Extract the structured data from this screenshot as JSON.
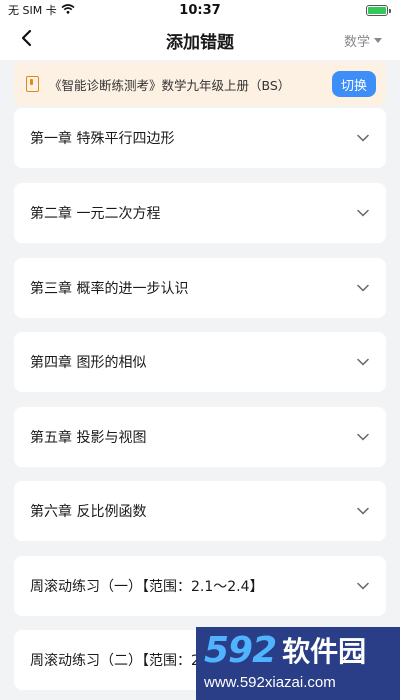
{
  "status_bar": {
    "carrier": "无 SIM 卡",
    "time": "10:37"
  },
  "nav": {
    "title": "添加错题",
    "subject": "数学"
  },
  "book": {
    "title": "《智能诊断练测考》数学九年级上册（BS）",
    "switch_label": "切换"
  },
  "chapters": [
    {
      "label": "第一章  特殊平行四边形"
    },
    {
      "label": "第二章 一元二次方程"
    },
    {
      "label": "第三章 概率的进一步认识"
    },
    {
      "label": "第四章 图形的相似"
    },
    {
      "label": "第五章 投影与视图"
    },
    {
      "label": "第六章 反比例函数"
    },
    {
      "label": "周滚动练习（一）【范围：2.1～2.4】"
    },
    {
      "label": "周滚动练习（二）【范围：2.5～2.6】"
    }
  ],
  "watermark": {
    "number": "592",
    "text": "软件园",
    "url": "www.592xiazai.com"
  },
  "colors": {
    "accent": "#3d8ef7",
    "banner_bg": "#fdf1e4",
    "book_icon": "#e08a1e",
    "page_bg": "#f2f3f5"
  }
}
